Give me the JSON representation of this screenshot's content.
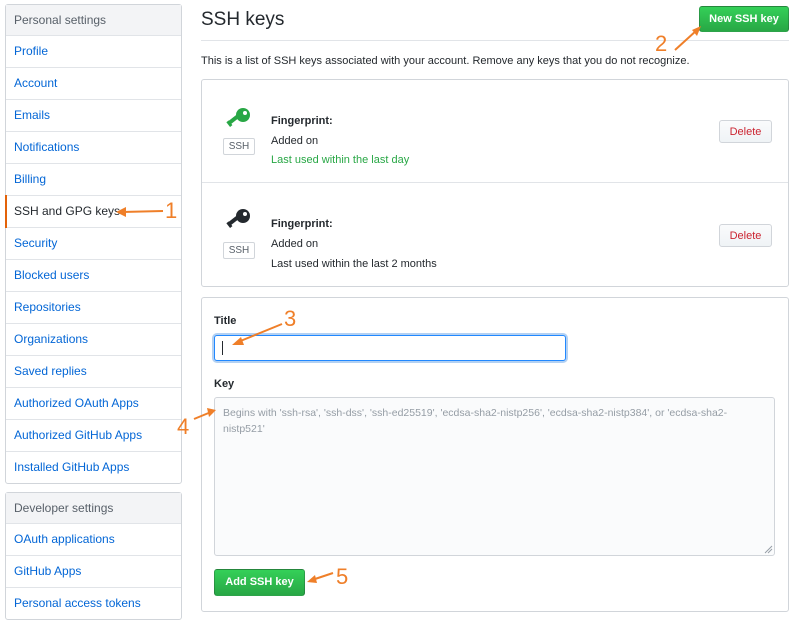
{
  "personal_settings": {
    "heading": "Personal settings",
    "items": [
      {
        "label": "Profile"
      },
      {
        "label": "Account"
      },
      {
        "label": "Emails"
      },
      {
        "label": "Notifications"
      },
      {
        "label": "Billing"
      },
      {
        "label": "SSH and GPG keys",
        "active": true
      },
      {
        "label": "Security"
      },
      {
        "label": "Blocked users"
      },
      {
        "label": "Repositories"
      },
      {
        "label": "Organizations"
      },
      {
        "label": "Saved replies"
      },
      {
        "label": "Authorized OAuth Apps"
      },
      {
        "label": "Authorized GitHub Apps"
      },
      {
        "label": "Installed GitHub Apps"
      }
    ]
  },
  "developer_settings": {
    "heading": "Developer settings",
    "items": [
      {
        "label": "OAuth applications"
      },
      {
        "label": "GitHub Apps"
      },
      {
        "label": "Personal access tokens"
      }
    ]
  },
  "page": {
    "title": "SSH keys",
    "new_key_button": "New SSH key",
    "intro": "This is a list of SSH keys associated with your account. Remove any keys that you do not recognize."
  },
  "keys": [
    {
      "badge": "SSH",
      "fingerprint_label": "Fingerprint:",
      "added": "Added on",
      "last_used": "Last used within the last day",
      "icon_color": "#28a745",
      "delete_label": "Delete"
    },
    {
      "badge": "SSH",
      "fingerprint_label": "Fingerprint:",
      "added": "Added on",
      "last_used": "Last used within the last 2 months",
      "icon_color": "#24292e",
      "delete_label": "Delete"
    }
  ],
  "form": {
    "title_label": "Title",
    "title_value": "",
    "key_label": "Key",
    "key_placeholder": "Begins with 'ssh-rsa', 'ssh-dss', 'ssh-ed25519', 'ecdsa-sha2-nistp256', 'ecdsa-sha2-nistp384', or 'ecdsa-sha2-nistp521'",
    "submit_label": "Add SSH key"
  },
  "annotations": [
    "1",
    "2",
    "3",
    "4",
    "5"
  ],
  "colors": {
    "accent": "#ef7f29",
    "green": "#28a745",
    "link": "#0366d6",
    "danger": "#cb2431"
  }
}
